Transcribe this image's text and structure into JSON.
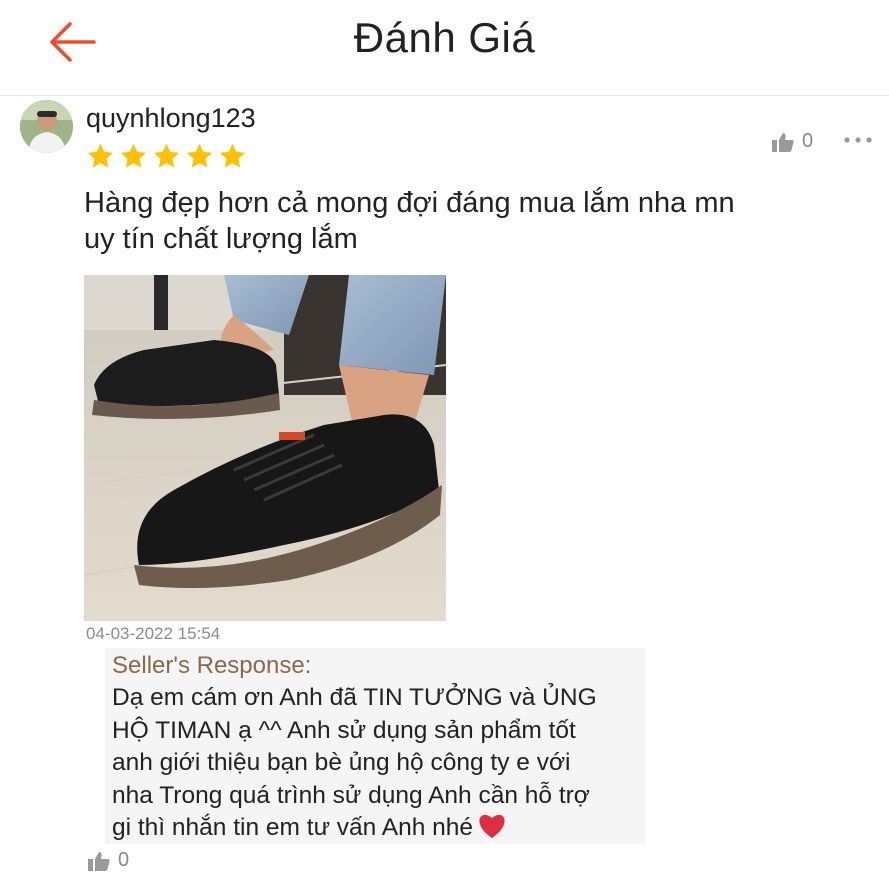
{
  "header": {
    "title": "Đánh Giá",
    "back_icon": "arrow-left-icon",
    "accent": "#ee4d2d"
  },
  "review": {
    "username": "quynhlong123",
    "rating": 5,
    "star_color": "#ffc107",
    "like_count": "0",
    "text_lines": [
      "Hàng đẹp hơn cả mong đợi đáng mua lắm nha mn",
      "uy tín chất lượng lắm"
    ],
    "photo_icon": "product-photo-black-leather-shoes",
    "timestamp": "04-03-2022 15:54"
  },
  "seller_response": {
    "title": "Seller's Response:",
    "lines": [
      "Dạ em cám ơn Anh đã TIN TƯỞNG và ỦNG",
      "HỘ TIMAN ạ ^^ Anh sử dụng sản phẩm tốt",
      "anh giới thiệu bạn bè ủng hộ công ty e với",
      "nha Trong quá trình sử dụng Anh cần hỗ trợ",
      "gi thì nhắn tin em tư vấn Anh nhé"
    ],
    "emoji": "heart-icon",
    "like_count": "0"
  }
}
